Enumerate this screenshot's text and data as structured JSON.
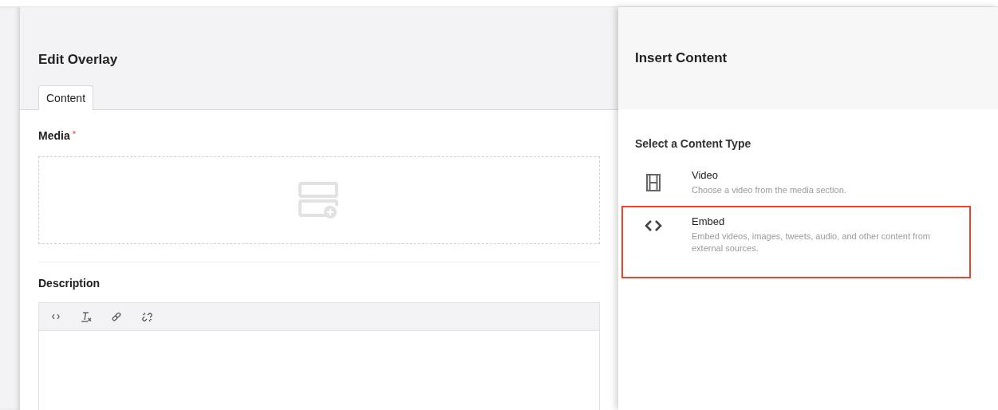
{
  "editor": {
    "title": "Edit Overlay",
    "tabs": [
      {
        "label": "Content",
        "selected": true
      }
    ],
    "media_field": {
      "label": "Media",
      "required_mark": "*"
    },
    "description_field": {
      "label": "Description",
      "toolbar": [
        {
          "kind": "source"
        },
        {
          "kind": "clear-format"
        },
        {
          "kind": "link"
        },
        {
          "kind": "unlink"
        }
      ]
    }
  },
  "insert_panel": {
    "title": "Insert Content",
    "subtitle": "Select a Content Type",
    "items": [
      {
        "kind": "video",
        "name": "Video",
        "description": "Choose a video from the media section.",
        "highlighted": false
      },
      {
        "kind": "embed",
        "name": "Embed",
        "description": "Embed videos, images, tweets, audio, and other content from external sources.",
        "highlighted": true
      }
    ]
  }
}
